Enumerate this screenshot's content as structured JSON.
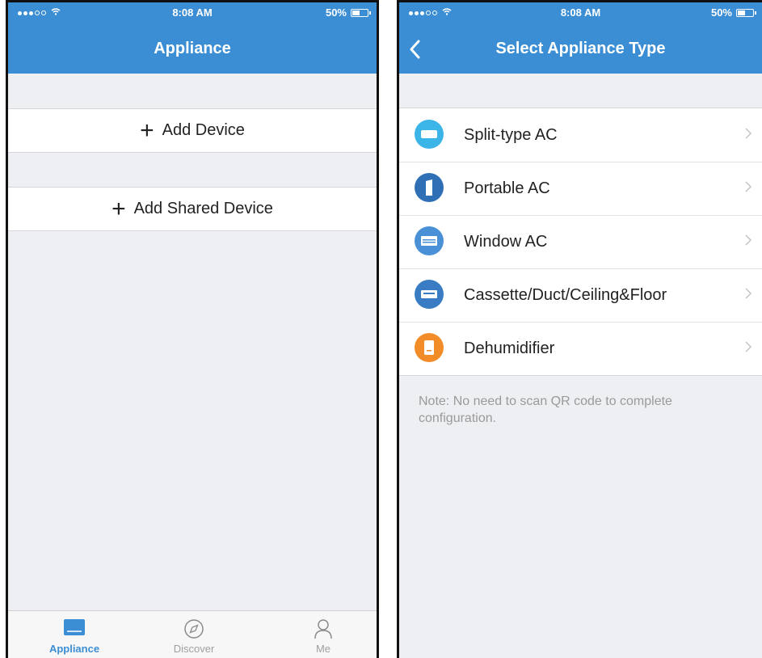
{
  "left_screen": {
    "status_bar": {
      "time": "8:08 AM",
      "battery": "50%"
    },
    "header": {
      "title": "Appliance"
    },
    "actions": [
      {
        "label": "Add Device",
        "icon": "plus-icon"
      },
      {
        "label": "Add Shared Device",
        "icon": "plus-icon"
      }
    ],
    "tab_bar": [
      {
        "label": "Appliance",
        "icon": "appliance-icon",
        "active": true
      },
      {
        "label": "Discover",
        "icon": "compass-icon",
        "active": false
      },
      {
        "label": "Me",
        "icon": "person-icon",
        "active": false
      }
    ]
  },
  "right_screen": {
    "status_bar": {
      "time": "8:08 AM",
      "battery": "50%"
    },
    "header": {
      "title": "Select Appliance Type",
      "back_icon": "chevron-left-icon"
    },
    "appliance_types": [
      {
        "label": "Split-type AC",
        "icon": "split-ac-icon",
        "color": "#3bb4e8"
      },
      {
        "label": "Portable AC",
        "icon": "portable-ac-icon",
        "color": "#2f6fb6"
      },
      {
        "label": "Window AC",
        "icon": "window-ac-icon",
        "color": "#4a90d6"
      },
      {
        "label": "Cassette/Duct/Ceiling&Floor",
        "icon": "cassette-ac-icon",
        "color": "#3a7cc4"
      },
      {
        "label": "Dehumidifier",
        "icon": "dehumidifier-icon",
        "color": "#f28c28"
      }
    ],
    "note": "Note: No need to scan QR code to complete configuration."
  },
  "colors": {
    "header": "#3b8ed3",
    "background": "#eeeff3",
    "tab_active": "#3b8ed3"
  }
}
